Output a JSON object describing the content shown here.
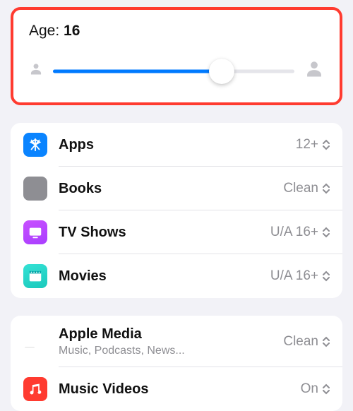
{
  "age": {
    "label": "Age: ",
    "value": "16",
    "slider_percent": 70
  },
  "group1": [
    {
      "icon": "apps",
      "title": "Apps",
      "value": "12+"
    },
    {
      "icon": "books",
      "title": "Books",
      "value": "Clean"
    },
    {
      "icon": "tv",
      "title": "TV Shows",
      "value": "U/A 16+"
    },
    {
      "icon": "movies",
      "title": "Movies",
      "value": "U/A 16+"
    }
  ],
  "group2": [
    {
      "icon": "applemedia",
      "title": "Apple Media",
      "subtitle": "Music, Podcasts, News...",
      "value": "Clean"
    },
    {
      "icon": "musicvid",
      "title": "Music Videos",
      "value": "On"
    }
  ]
}
